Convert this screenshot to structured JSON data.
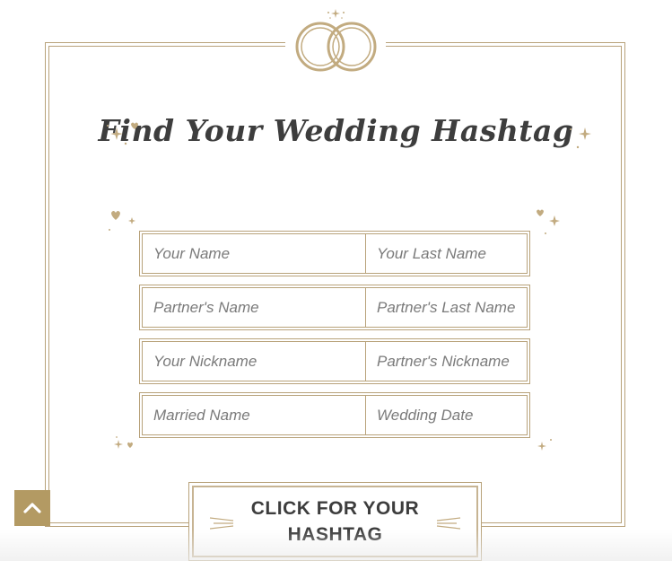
{
  "title": "Find Your Wedding Hashtag",
  "form": {
    "rows": [
      {
        "left_placeholder": "Your Name",
        "right_placeholder": "Your Last Name"
      },
      {
        "left_placeholder": "Partner's Name",
        "right_placeholder": "Partner's Last Name"
      },
      {
        "left_placeholder": "Your Nickname",
        "right_placeholder": "Partner's Nickname"
      },
      {
        "left_placeholder": "Married Name",
        "right_placeholder": "Wedding Date"
      }
    ]
  },
  "cta": {
    "line1": "CLICK FOR YOUR",
    "line2": "HASHTAG"
  },
  "icons": {
    "rings": "wedding-rings-icon",
    "scroll_top": "chevron-up-icon"
  },
  "colors": {
    "gold": "#b8a27a",
    "button_gold": "#b39a63",
    "text": "#3d3d3d"
  }
}
